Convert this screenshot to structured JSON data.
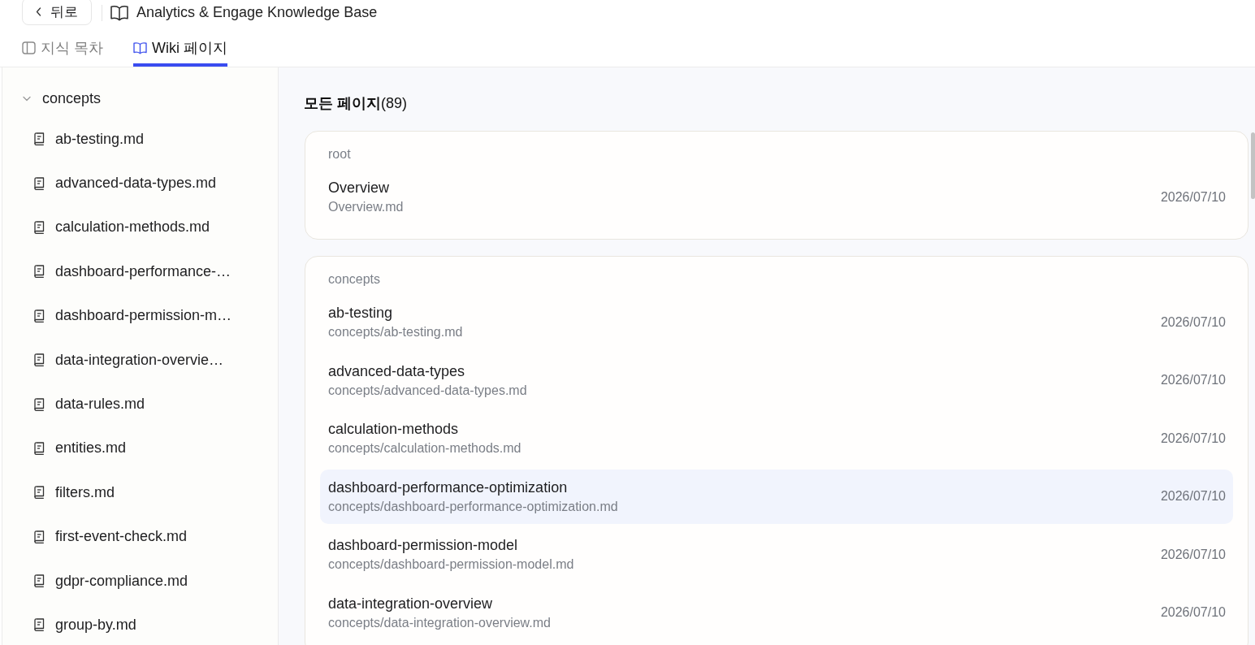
{
  "header": {
    "back_button": {
      "label": "뒤로"
    },
    "title": "Analytics & Engage Knowledge Base"
  },
  "tabs": [
    {
      "label": "지식 목차",
      "kind": "panel",
      "selected": false
    },
    {
      "label": "Wiki 페이지",
      "kind": "book",
      "selected": true
    }
  ],
  "sidebar": {
    "tree": [
      {
        "label": "concepts",
        "expanded": true,
        "children": [
          {
            "label": "ab-testing.md"
          },
          {
            "label": "advanced-data-types.md"
          },
          {
            "label": "calculation-methods.md"
          },
          {
            "label": "dashboard-performance-…"
          },
          {
            "label": "dashboard-permission-m…"
          },
          {
            "label": "data-integration-overvie…"
          },
          {
            "label": "data-rules.md"
          },
          {
            "label": "entities.md"
          },
          {
            "label": "filters.md"
          },
          {
            "label": "first-event-check.md"
          },
          {
            "label": "gdpr-compliance.md"
          },
          {
            "label": "group-by.md"
          }
        ]
      }
    ]
  },
  "main": {
    "heading": "**모든 페이지**(89)",
    "groups": [
      {
        "label": "root",
        "pages": [
          {
            "title": "Overview",
            "path": "Overview.md",
            "date": "2026/07/10",
            "selected": false
          }
        ]
      },
      {
        "label": "concepts",
        "pages": [
          {
            "title": "ab-testing",
            "path": "concepts/ab-testing.md",
            "date": "2026/07/10",
            "selected": false
          },
          {
            "title": "advanced-data-types",
            "path": "concepts/advanced-data-types.md",
            "date": "2026/07/10",
            "selected": false
          },
          {
            "title": "calculation-methods",
            "path": "concepts/calculation-methods.md",
            "date": "2026/07/10",
            "selected": false
          },
          {
            "title": "dashboard-performance-optimization",
            "path": "concepts/dashboard-performance-optimization.md",
            "date": "2026/07/10",
            "selected": true
          },
          {
            "title": "dashboard-permission-model",
            "path": "concepts/dashboard-permission-model.md",
            "date": "2026/07/10",
            "selected": false
          },
          {
            "title": "data-integration-overview",
            "path": "concepts/data-integration-overview.md",
            "date": "2026/07/10",
            "selected": false
          }
        ]
      }
    ]
  }
}
